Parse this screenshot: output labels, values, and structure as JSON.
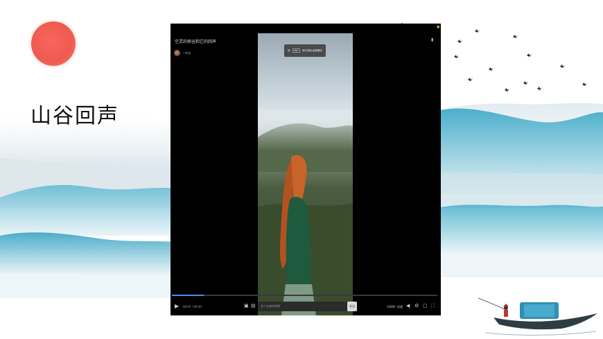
{
  "slide": {
    "title": "山谷回声"
  },
  "player": {
    "video_title": "空灵的峡谷和它的回声",
    "uploader": "一书法",
    "tooltip": {
      "prefix": "按",
      "key": "esc",
      "suffix": "即可退出全屏模式"
    },
    "progress": 0.12,
    "time": "00:07 / 00:50",
    "danmu_placeholder": "发个友善的弹幕",
    "send_label": "发送",
    "quality_label": "1080P",
    "speed_label": "倍速"
  },
  "colors": {
    "sun": "#ef5a50",
    "progress": "#4a8fe7",
    "player_bg": "#000000",
    "ink_blue": "#3ea9c6"
  },
  "icons": [
    "play-icon",
    "danmu-toggle-icon",
    "danmu-settings-icon",
    "volume-icon",
    "settings-icon",
    "pip-icon",
    "fullscreen-icon",
    "bookmark-icon"
  ]
}
